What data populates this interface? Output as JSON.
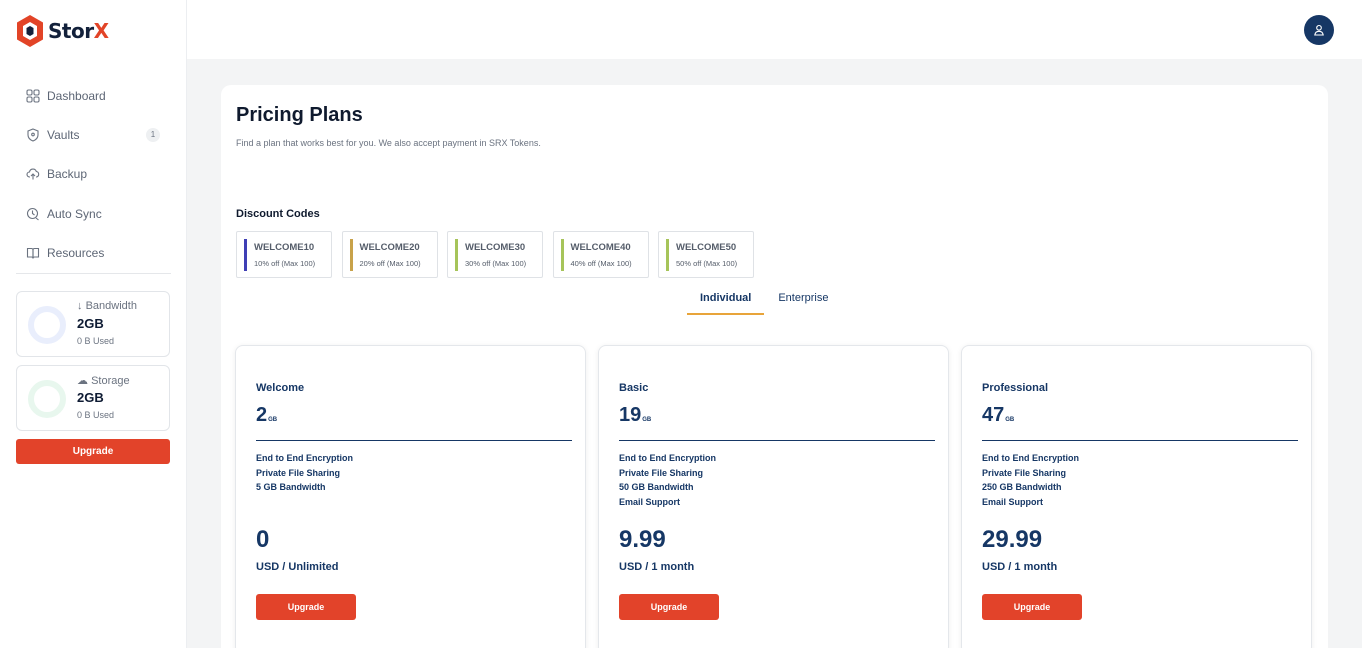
{
  "brand": {
    "name_part1": "Stor",
    "name_part2": "X",
    "accent": "#e24427",
    "navy": "#163765"
  },
  "sidebar": {
    "items": [
      {
        "label": "Dashboard",
        "icon": "grid-icon"
      },
      {
        "label": "Vaults",
        "icon": "shield-icon",
        "badge": "1"
      },
      {
        "label": "Backup",
        "icon": "cloud-upload-icon"
      },
      {
        "label": "Auto Sync",
        "icon": "sync-icon"
      },
      {
        "label": "Resources",
        "icon": "book-icon"
      }
    ],
    "bandwidth": {
      "title": "Bandwidth",
      "value": "2GB",
      "used": "0 B Used"
    },
    "storage": {
      "title": "Storage",
      "value": "2GB",
      "used": "0 B Used"
    },
    "upgrade_label": "Upgrade"
  },
  "header": {
    "avatar_icon": "user-icon"
  },
  "main": {
    "title": "Pricing Plans",
    "subtitle": "Find a plan that works best for you. We also accept payment in SRX Tokens.",
    "discount_title": "Discount Codes",
    "discount_codes": [
      {
        "code": "WELCOME10",
        "desc": "10% off (Max 100)",
        "color": "#3f3fb5"
      },
      {
        "code": "WELCOME20",
        "desc": "20% off (Max 100)",
        "color": "#c8a24a"
      },
      {
        "code": "WELCOME30",
        "desc": "30% off (Max 100)",
        "color": "#a6c45a"
      },
      {
        "code": "WELCOME40",
        "desc": "40% off (Max 100)",
        "color": "#a6c45a"
      },
      {
        "code": "WELCOME50",
        "desc": "50% off (Max 100)",
        "color": "#a6c45a"
      }
    ],
    "tabs": [
      {
        "label": "Individual",
        "active": true
      },
      {
        "label": "Enterprise",
        "active": false
      }
    ],
    "plans": [
      {
        "name": "Welcome",
        "size": "2",
        "unit": "GB",
        "features": [
          "End to End Encryption",
          "Private File Sharing",
          "5 GB Bandwidth"
        ],
        "price": "0",
        "period": "USD / Unlimited",
        "button": "Upgrade"
      },
      {
        "name": "Basic",
        "size": "19",
        "unit": "GB",
        "features": [
          "End to End Encryption",
          "Private File Sharing",
          "50 GB Bandwidth",
          "Email Support"
        ],
        "price": "9.99",
        "period": "USD / 1 month",
        "button": "Upgrade"
      },
      {
        "name": "Professional",
        "size": "47",
        "unit": "GB",
        "features": [
          "End to End Encryption",
          "Private File Sharing",
          "250 GB Bandwidth",
          "Email Support"
        ],
        "price": "29.99",
        "period": "USD / 1 month",
        "button": "Upgrade"
      }
    ]
  }
}
